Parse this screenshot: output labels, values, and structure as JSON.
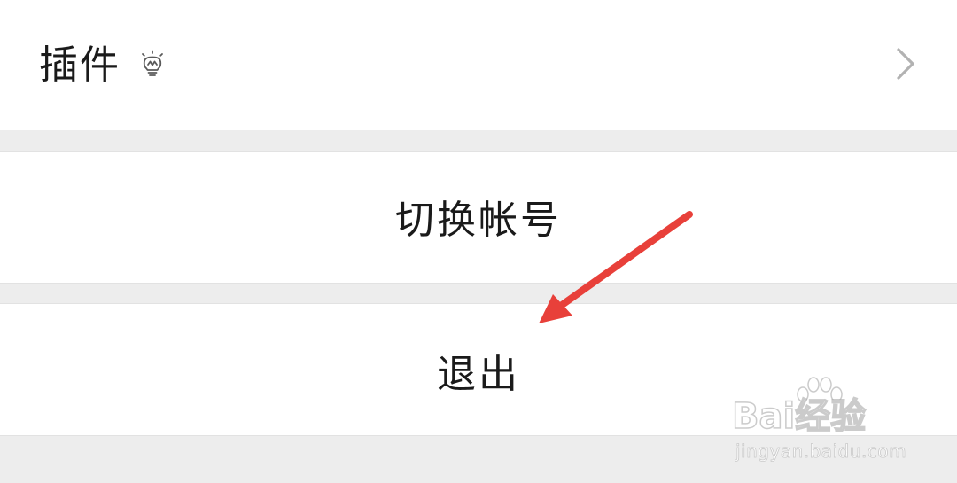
{
  "settings": {
    "plugins": {
      "label": "插件",
      "icon": "lightbulb-icon",
      "chevron_icon": "chevron-right-icon"
    },
    "switch_account": {
      "label": "切换帐号"
    },
    "logout": {
      "label": "退出"
    }
  },
  "annotation": {
    "arrow_color": "#e8403a"
  },
  "watermark": {
    "brand": "Bai经验",
    "url": "jingyan.baidu.com"
  },
  "colors": {
    "background": "#ededed",
    "row": "#ffffff",
    "text": "#1a1a1a",
    "chevron": "#b2b2b2"
  }
}
